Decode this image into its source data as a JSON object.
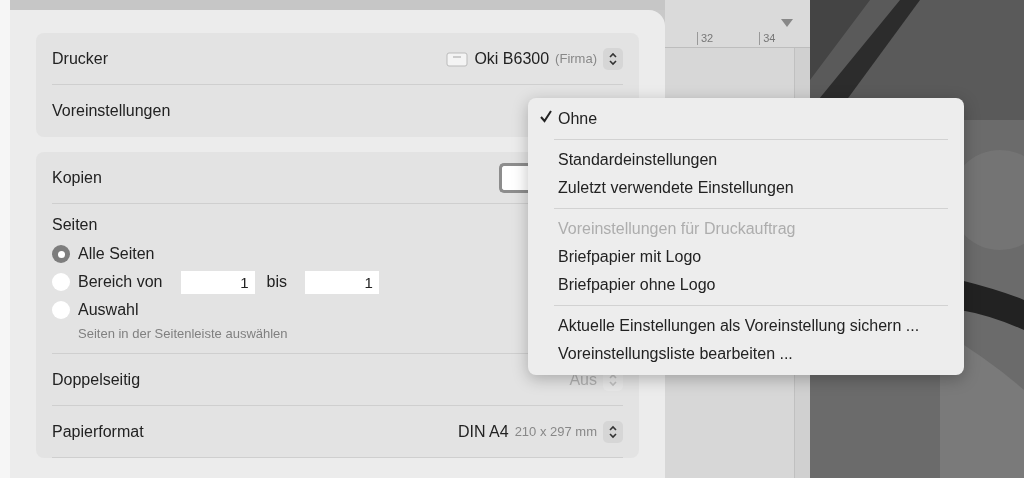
{
  "printer": {
    "label": "Drucker",
    "name": "Oki B6300",
    "location": "(Firma)"
  },
  "presets": {
    "label": "Voreinstellungen"
  },
  "copies": {
    "label": "Kopien"
  },
  "pages": {
    "label": "Seiten",
    "options": [
      {
        "label": "Alle Seiten",
        "selected": true
      },
      {
        "label": "Bereich von",
        "selected": false,
        "from": "1",
        "to_label": "bis",
        "to": "1"
      },
      {
        "label": "Auswahl",
        "selected": false,
        "hint": "Seiten in der Seitenleiste auswählen"
      }
    ]
  },
  "settings": [
    {
      "label": "Doppelseitig",
      "value": "Aus",
      "disabled": true
    },
    {
      "label": "Papierformat",
      "value": "DIN A4",
      "detail": "210 x 297 mm",
      "disabled": false
    }
  ],
  "ruler": {
    "ticks": [
      "32",
      "34"
    ]
  },
  "menu": {
    "items": [
      {
        "kind": "option",
        "label": "Ohne",
        "checked": true,
        "disabled": false
      },
      {
        "kind": "separator"
      },
      {
        "kind": "option",
        "label": "Standardeinstellungen",
        "checked": false,
        "disabled": false
      },
      {
        "kind": "option",
        "label": "Zuletzt verwendete Einstellungen",
        "checked": false,
        "disabled": false
      },
      {
        "kind": "separator"
      },
      {
        "kind": "option",
        "label": "Voreinstellungen für Druckauftrag",
        "checked": false,
        "disabled": true
      },
      {
        "kind": "option",
        "label": "Briefpapier mit Logo",
        "checked": false,
        "disabled": false
      },
      {
        "kind": "option",
        "label": "Briefpapier ohne Logo",
        "checked": false,
        "disabled": false
      },
      {
        "kind": "separator"
      },
      {
        "kind": "option",
        "label": "Aktuelle Einstellungen als Voreinstellung sichern ...",
        "checked": false,
        "disabled": false
      },
      {
        "kind": "option",
        "label": "Voreinstellungsliste bearbeiten ...",
        "checked": false,
        "disabled": false
      }
    ]
  }
}
